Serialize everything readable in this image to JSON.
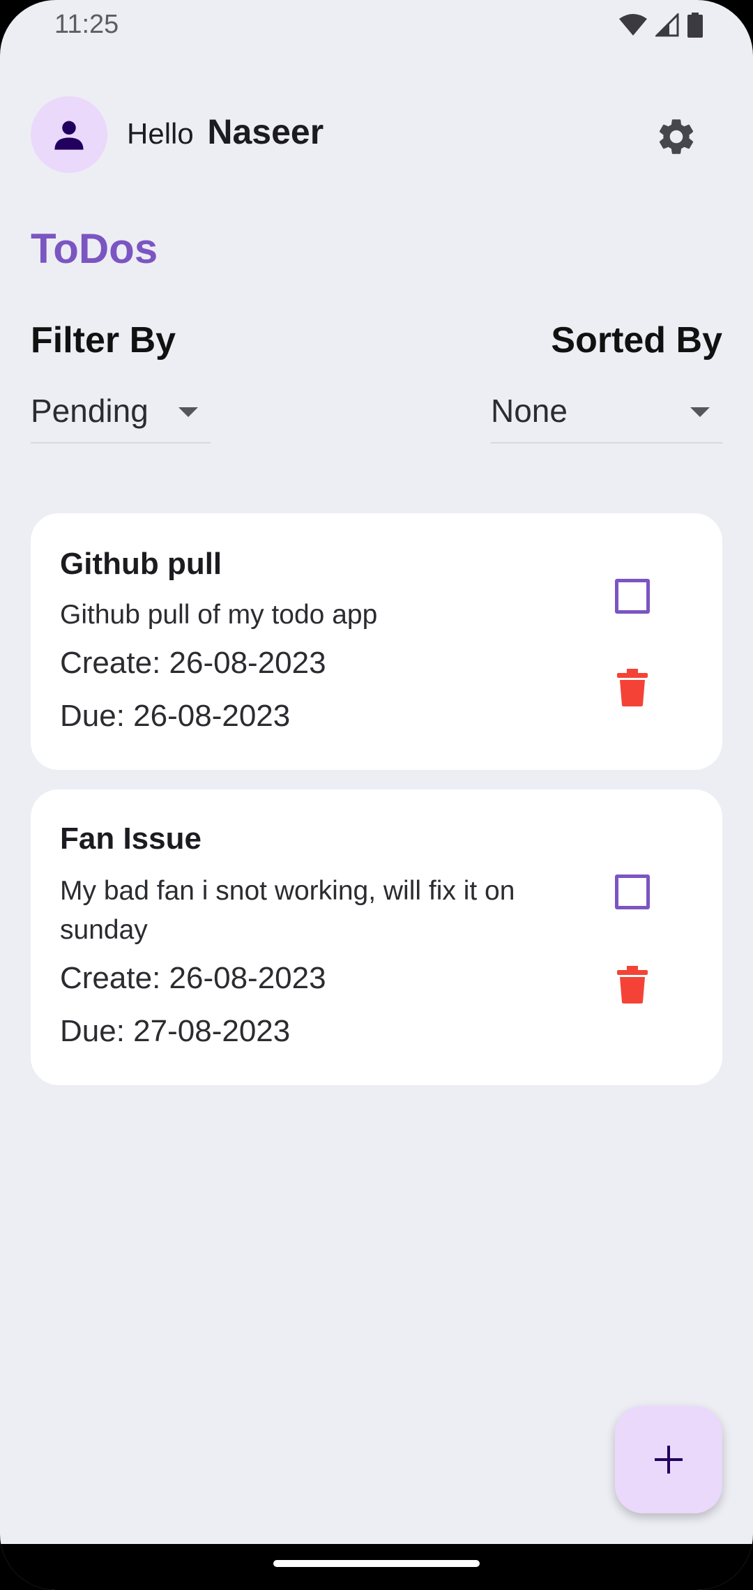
{
  "status_bar": {
    "time": "11:25"
  },
  "header": {
    "greeting_prefix": "Hello",
    "user_name": "Naseer"
  },
  "page_title": "ToDos",
  "filters": {
    "filter_label": "Filter By",
    "filter_value": "Pending",
    "sort_label": "Sorted By",
    "sort_value": "None"
  },
  "todos": [
    {
      "title": "Github pull",
      "description": "Github pull of my todo app",
      "created": "Create: 26-08-2023",
      "due": "Due: 26-08-2023",
      "done": false
    },
    {
      "title": "Fan Issue",
      "description": "My bad fan i snot working, will fix it on sunday",
      "created": "Create: 26-08-2023",
      "due": "Due: 27-08-2023",
      "done": false
    }
  ],
  "colors": {
    "accent": "#7b55c2",
    "delete": "#f44336",
    "background": "#edeef4",
    "fab": "#ead9fb"
  },
  "icons": {
    "avatar": "person-icon",
    "settings": "gear-icon",
    "delete": "trash-icon",
    "fab": "plus-icon"
  }
}
